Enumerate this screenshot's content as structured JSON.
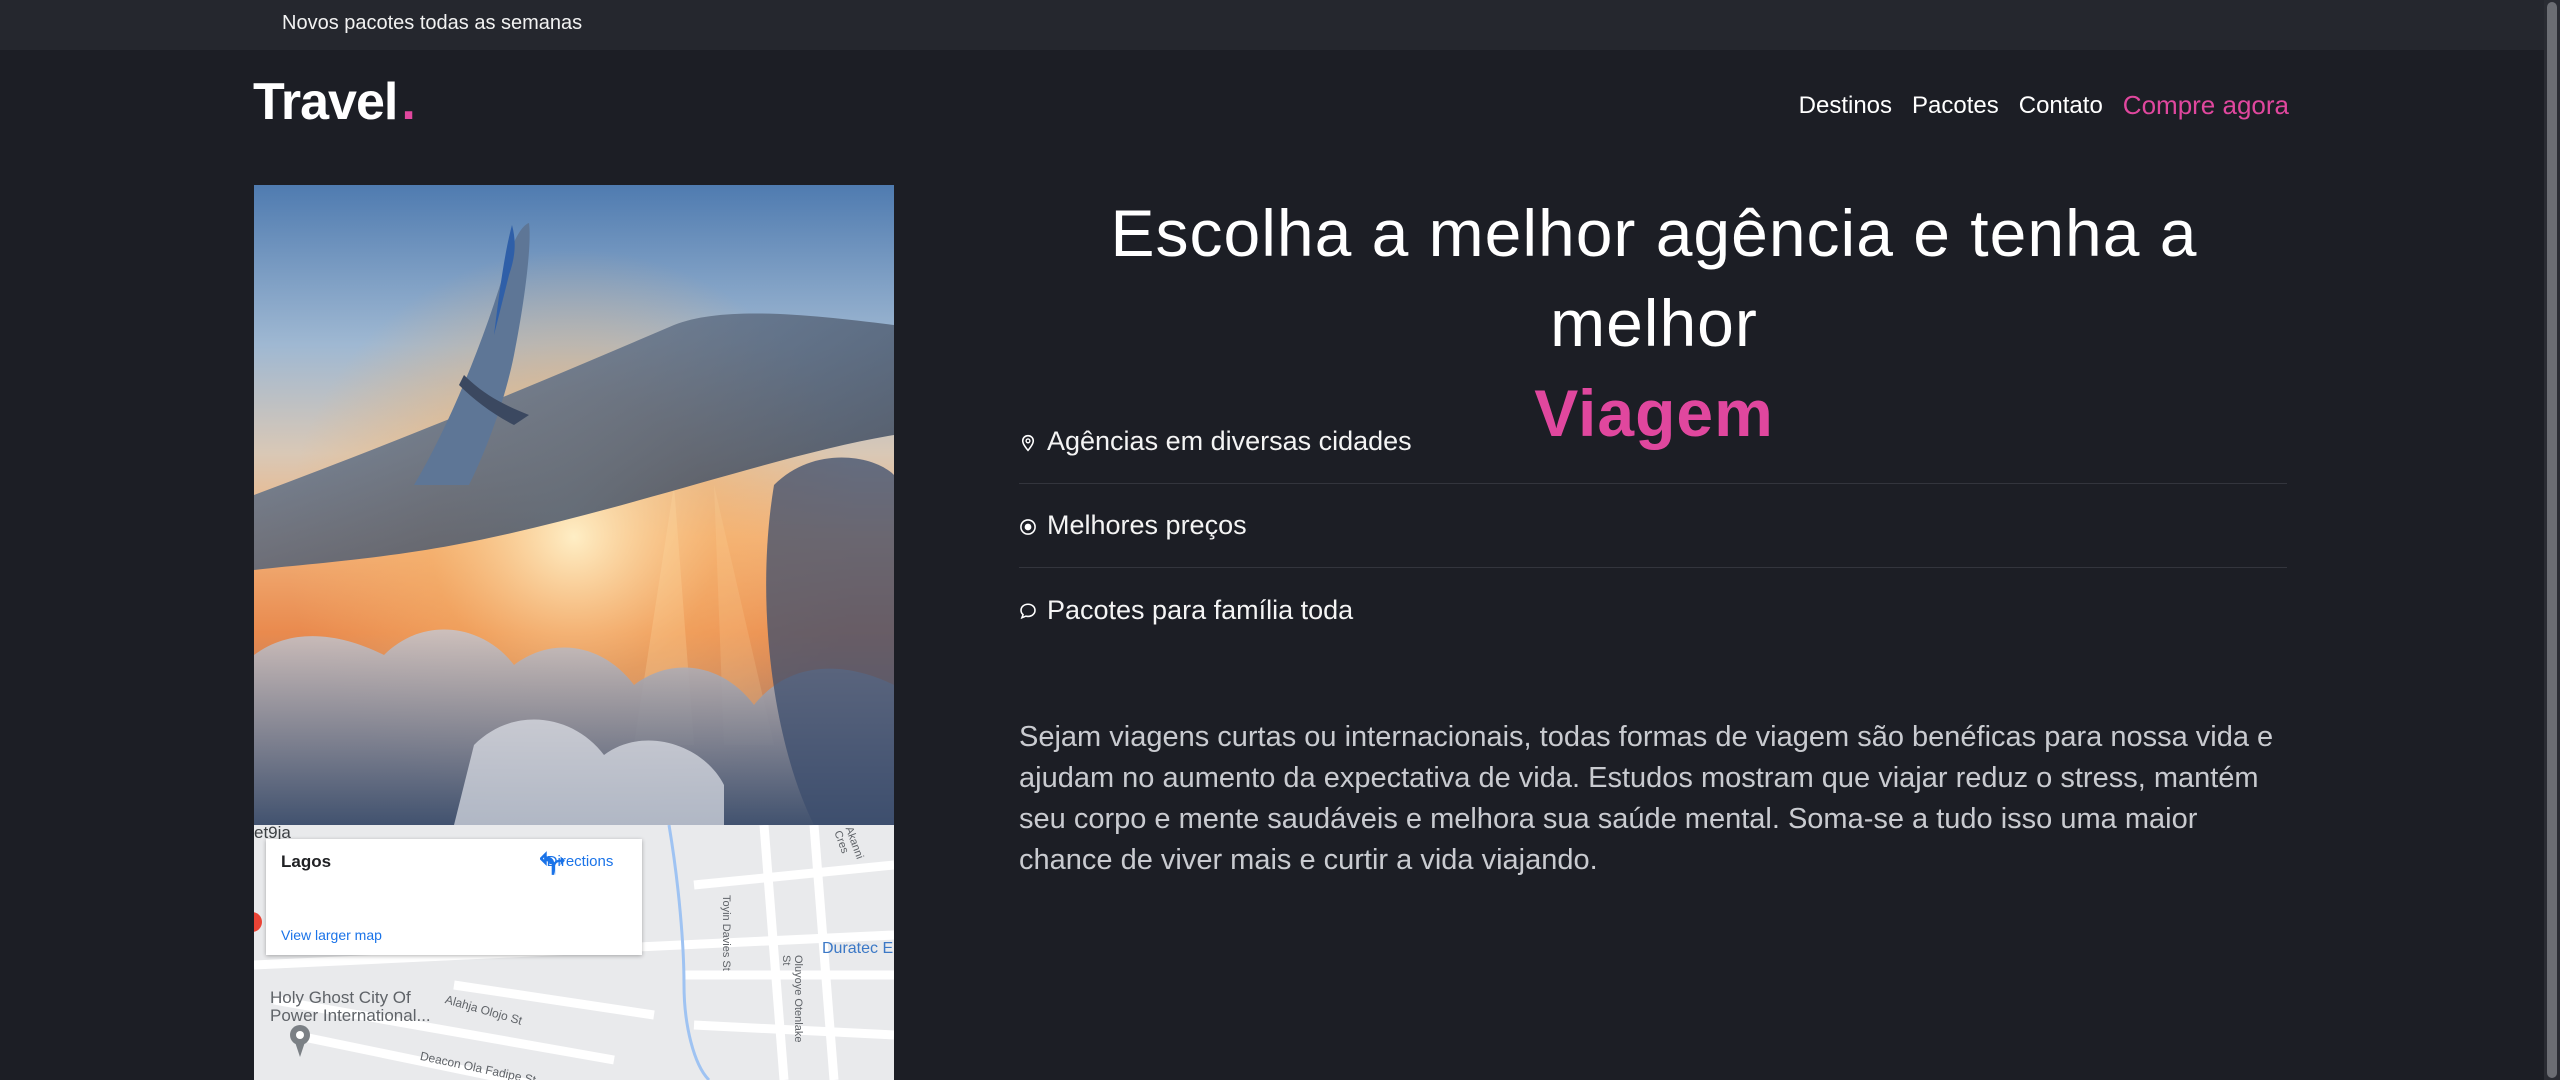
{
  "topbar": {
    "text": "Novos pacotes todas as semanas"
  },
  "header": {
    "logo_text": "Travel",
    "logo_dot": ".",
    "nav": [
      "Destinos",
      "Pacotes",
      "Contato"
    ],
    "cta": "Compre agora"
  },
  "colors": {
    "accent": "#e0479e",
    "background": "#1c1e25",
    "topbar": "#25272e"
  },
  "map": {
    "place": "Lagos",
    "directions": "Directions",
    "larger_map": "View larger map",
    "labels": [
      "et9ja",
      "Holy Ghost City Of",
      "Power International...",
      "Alahja Olojo St",
      "Deacon Ola Fadipe St",
      "Duratec E",
      "Toyin Davies St",
      "Oluyoye Otenlake St",
      "Akanni Cres"
    ]
  },
  "hero": {
    "title": "Escolha a melhor agência e tenha a melhor",
    "accent": "Viagem"
  },
  "features": [
    {
      "icon": "map-pin-icon",
      "label": "Agências em diversas cidades"
    },
    {
      "icon": "record-circle-icon",
      "label": "Melhores preços"
    },
    {
      "icon": "chat-bubble-icon",
      "label": "Pacotes para família toda"
    }
  ],
  "description": "Sejam viagens curtas ou internacionais, todas formas de viagem são benéficas para nossa vida e ajudam no aumento da expectativa de vida. Estudos mostram que viajar reduz o stress, mantém seu corpo e mente saudáveis e melhora sua saúde mental. Soma-se a tudo isso uma maior chance de viver mais e curtir a vida viajando."
}
